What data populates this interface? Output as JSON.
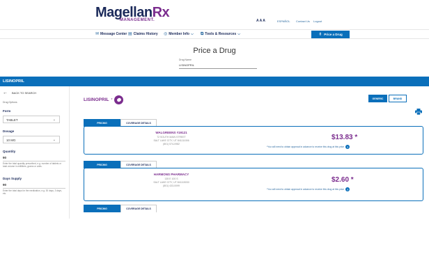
{
  "header": {
    "brand_main": "Magellan",
    "brand_rx": "Rx",
    "brand_sub": "MANAGEMENT.",
    "text_size": "A A A",
    "language": "ESPAÑOL",
    "contact": "Contact Us",
    "logout": "Logout"
  },
  "nav": {
    "message_center": "Message Center",
    "claims_history": "Claims History",
    "member_info": "Member Info",
    "tools_resources": "Tools & Resources",
    "price_a_drug": "Price a Drug"
  },
  "page": {
    "title": "Price a Drug",
    "drug_name_label": "Drug Name",
    "drug_name_value": "LISINOPRIL",
    "selected_drug_bar": "LISINOPRIL"
  },
  "sidebar": {
    "back": "BACK TO SEARCH",
    "drug_options": "Drug Options",
    "form_label": "Form",
    "form_value": "TABLET",
    "dosage_label": "Dosage",
    "dosage_value": "10 MG",
    "quantity_label": "Quantity",
    "quantity_value": "90",
    "quantity_help": "Enter the total quantity prescribed, e.g. number of tablets or total volume in milliliters, grams or units.",
    "days_label": "Days Supply",
    "days_value": "90",
    "days_help": "Enter the total days for the medication, e.g. 30 days, 3 days, etc."
  },
  "main": {
    "drug_title": "LISINOPRIL",
    "drug_title_mark": "*",
    "generic_label": "GENERIC",
    "brand_label": "BRAND",
    "pricing_tab": "PRICING",
    "coverage_tab": "COVERAGE DETAILS",
    "note": "*You will need to obtain approval in advance to receive this drug at this price"
  },
  "pharmacies": [
    {
      "name": "WALGREENS #19121",
      "address1": "72 SOUTH MAIN STREET",
      "address2": "SALT LAKE CITY, UT 841111006",
      "phone": "(801) 574-0982",
      "price": "$13.83 *"
    },
    {
      "name": "HARMONS PHARMACY",
      "address1": "135 E 100 S",
      "address2": "SALT LAKE CITY, UT 841115030",
      "phone": "(801) 433-0099",
      "price": "$2.60 *"
    }
  ],
  "colors": {
    "primary": "#0a6fba",
    "brand_navy": "#1b2a5a",
    "accent_purple": "#7b2d8e"
  },
  "icons": {
    "message": "envelope-icon",
    "claims": "document-icon",
    "member": "person-icon",
    "tools": "tools-icon",
    "price": "pill-bottle-icon",
    "print": "printer-icon",
    "help": "question-icon"
  }
}
